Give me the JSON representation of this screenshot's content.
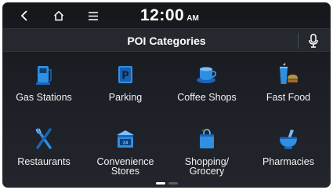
{
  "status": {
    "time": "12:00",
    "ampm": "AM"
  },
  "header": {
    "title": "POI Categories"
  },
  "categories": [
    {
      "label": "Gas Stations",
      "icon": "gas-pump-icon"
    },
    {
      "label": "Parking",
      "icon": "parking-icon"
    },
    {
      "label": "Coffee Shops",
      "icon": "coffee-cup-icon"
    },
    {
      "label": "Fast Food",
      "icon": "fast-food-icon"
    },
    {
      "label": "Restaurants",
      "icon": "fork-knife-icon"
    },
    {
      "label": "Convenience\nStores",
      "icon": "convenience-store-icon"
    },
    {
      "label": "Shopping/\nGrocery",
      "icon": "shopping-bag-icon"
    },
    {
      "label": "Pharmacies",
      "icon": "mortar-pestle-icon"
    }
  ],
  "pager": {
    "current": 1,
    "total": 2
  },
  "colors": {
    "icon_blue": "#2f8fe0",
    "icon_blue_dark": "#1b64b8",
    "accent_brown": "#a86a2e"
  }
}
